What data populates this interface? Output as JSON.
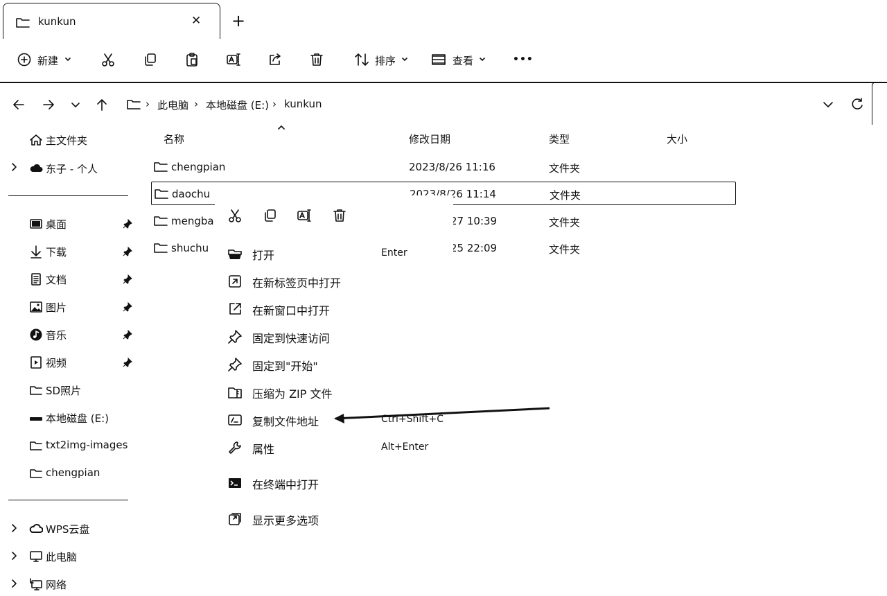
{
  "tab": {
    "title": "kunkun",
    "close": "✕",
    "new_tab": "+"
  },
  "toolbar": {
    "new_label": "新建",
    "sort_label": "排序",
    "view_label": "查看",
    "more": "•••"
  },
  "address": {
    "crumbs": [
      "此电脑",
      "本地磁盘 (E:)",
      "kunkun"
    ],
    "separator": "›"
  },
  "sidebar": {
    "home": "主文件夹",
    "cloud_personal": "东子 - 个人",
    "pinned": [
      {
        "label": "桌面",
        "icon": "desktop-icon"
      },
      {
        "label": "下载",
        "icon": "download-icon"
      },
      {
        "label": "文档",
        "icon": "document-icon"
      },
      {
        "label": "图片",
        "icon": "picture-icon"
      },
      {
        "label": "音乐",
        "icon": "music-icon"
      },
      {
        "label": "视频",
        "icon": "video-icon"
      }
    ],
    "folders": [
      "SD照片",
      "本地磁盘 (E:)",
      "txt2img-images",
      "chengpian"
    ],
    "bottom": [
      "WPS云盘",
      "此电脑",
      "网络"
    ]
  },
  "columns": {
    "name": "名称",
    "modified": "修改日期",
    "type": "类型",
    "size": "大小"
  },
  "files": [
    {
      "name": "chengpian",
      "date": "2023/8/26 11:16",
      "type": "文件夹"
    },
    {
      "name": "daochu",
      "date": "2023/8/26 11:14",
      "type": "文件夹"
    },
    {
      "name": "mengbai",
      "date": "27 10:39",
      "type": "文件夹"
    },
    {
      "name": "shuchu",
      "date": "25 22:09",
      "type": "文件夹"
    }
  ],
  "context_menu": {
    "items": [
      {
        "label": "打开",
        "shortcut": "Enter",
        "icon": "open-icon"
      },
      {
        "label": "在新标签页中打开",
        "shortcut": "",
        "icon": "new-tab-icon"
      },
      {
        "label": "在新窗口中打开",
        "shortcut": "",
        "icon": "new-window-icon"
      },
      {
        "label": "固定到快速访问",
        "shortcut": "",
        "icon": "pin-icon"
      },
      {
        "label": "固定到\"开始\"",
        "shortcut": "",
        "icon": "pin-icon"
      },
      {
        "label": "压缩为 ZIP 文件",
        "shortcut": "",
        "icon": "zip-icon"
      },
      {
        "label": "复制文件地址",
        "shortcut": "Ctrl+Shift+C",
        "icon": "copy-path-icon"
      },
      {
        "label": "属性",
        "shortcut": "Alt+Enter",
        "icon": "wrench-icon"
      },
      {
        "label": "在终端中打开",
        "shortcut": "",
        "icon": "terminal-icon"
      },
      {
        "label": "显示更多选项",
        "shortcut": "",
        "icon": "more-options-icon"
      }
    ]
  }
}
